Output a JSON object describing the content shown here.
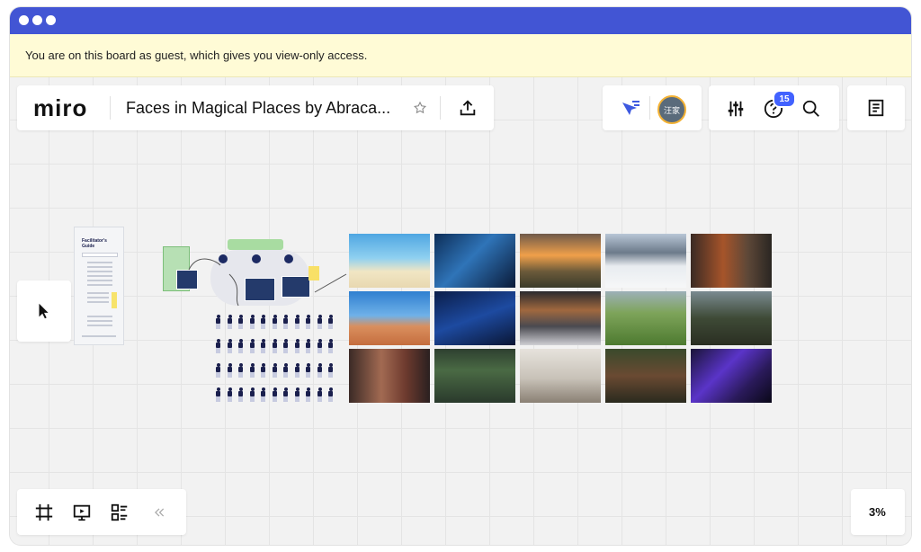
{
  "window": {
    "accent": "#4255d4"
  },
  "banner": {
    "text": "You are on this board as guest, which gives you view-only access."
  },
  "header": {
    "logo": "miro",
    "board_title": "Faces in Magical Places by Abraca...",
    "icons": {
      "star": "star-icon",
      "share": "upload-icon"
    }
  },
  "collab": {
    "avatar_text": "汪家",
    "cursor_icon": "cursor-follow-icon"
  },
  "tools": {
    "help_badge": "15",
    "icons": [
      "settings-sliders-icon",
      "help-icon",
      "search-icon"
    ]
  },
  "notes": {
    "icon": "notes-icon"
  },
  "left_toolbar": {
    "icon": "pointer-icon"
  },
  "bottom_toolbar": {
    "icons": [
      "frame-icon",
      "presentation-icon",
      "board-list-icon",
      "collapse-icon"
    ]
  },
  "zoom": {
    "level": "3%"
  },
  "board": {
    "guide_title": "Facilitator's Guide",
    "image_grid": [
      [
        "beach",
        "space-astronaut",
        "sunset-field",
        "snow-mountain",
        "city-street-cafe"
      ],
      [
        "desert-trees",
        "underwater-diver",
        "city-crosswalk",
        "green-hills",
        "castle-forest"
      ],
      [
        "market-alley",
        "jungle-ruins",
        "living-room",
        "forest-path",
        "concert-lights"
      ]
    ]
  }
}
